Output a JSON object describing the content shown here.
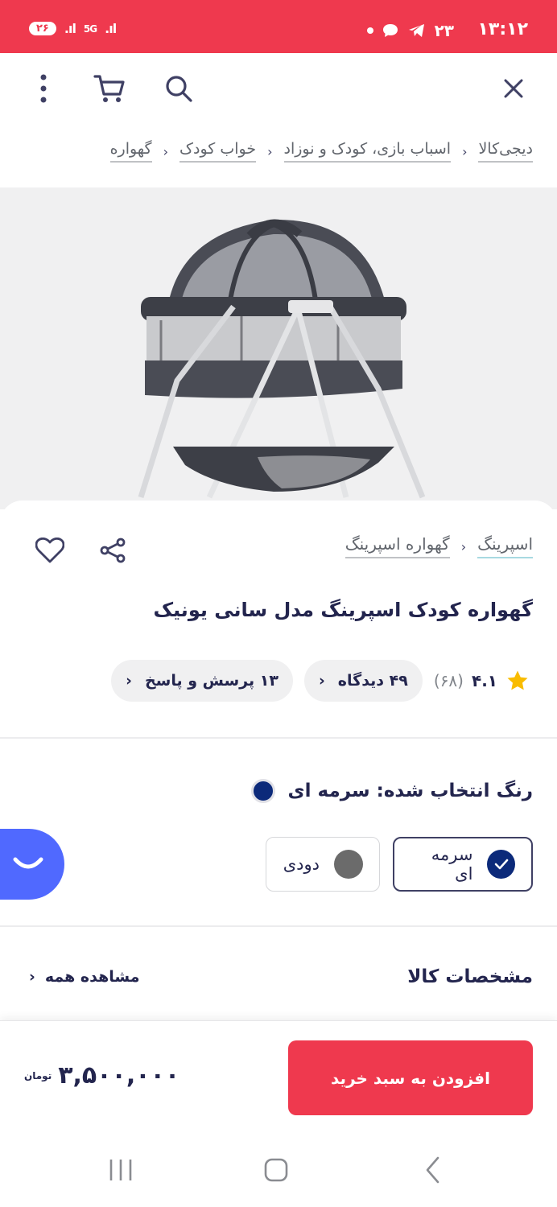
{
  "status_bar": {
    "time": "۱۳:۱۲",
    "temperature": "۲۳",
    "network": "5G",
    "battery": "۲۶"
  },
  "toolbar": {
    "icons": [
      "close-icon",
      "search-icon",
      "cart-icon",
      "more-vertical-icon"
    ]
  },
  "breadcrumb": [
    "دیجی‌کالا",
    "اسباب بازی، کودک و نوزاد",
    "خواب کودک",
    "گهواره"
  ],
  "product": {
    "brand": "اسپرینگ",
    "category": "گهواره اسپرینگ",
    "title": "گهواره کودک اسپرینگ مدل سانی یونیک",
    "rating": "۴.۱",
    "rating_count": "(۶۸)",
    "reviews": "۴۹ دیدگاه",
    "questions": "۱۳ پرسش و پاسخ"
  },
  "color": {
    "label": "رنگ انتخاب شده: سرمه ای",
    "selected_hex": "#0c2a7a",
    "options": [
      {
        "name": "سرمه ای",
        "hex": "#0c2a7a",
        "selected": true
      },
      {
        "name": "دودی",
        "hex": "#6b6b6b",
        "selected": false
      }
    ]
  },
  "specs": {
    "title": "مشخصات کالا",
    "see_all": "مشاهده همه"
  },
  "buy": {
    "add_to_cart": "افزودن به سبد خرید",
    "price": "۳,۵۰۰,۰۰۰",
    "currency": "تومان"
  },
  "colors": {
    "brand": "#ef394e",
    "chat": "#5069ff"
  }
}
